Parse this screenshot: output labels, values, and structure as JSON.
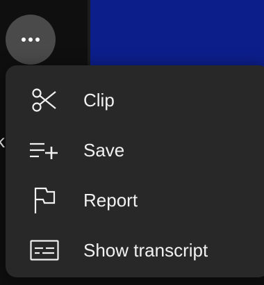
{
  "background_colors": {
    "page": "#0f0f0f",
    "video_thumbnail": "#0c1e8a",
    "menu": "#282828",
    "more_button": "#4a4a4a"
  },
  "partial_text": "k",
  "more_button": {
    "icon": "more-horizontal-icon"
  },
  "menu": {
    "items": [
      {
        "label": "Clip",
        "icon": "scissors-icon"
      },
      {
        "label": "Save",
        "icon": "playlist-add-icon"
      },
      {
        "label": "Report",
        "icon": "flag-icon"
      },
      {
        "label": "Show transcript",
        "icon": "transcript-icon"
      }
    ]
  }
}
